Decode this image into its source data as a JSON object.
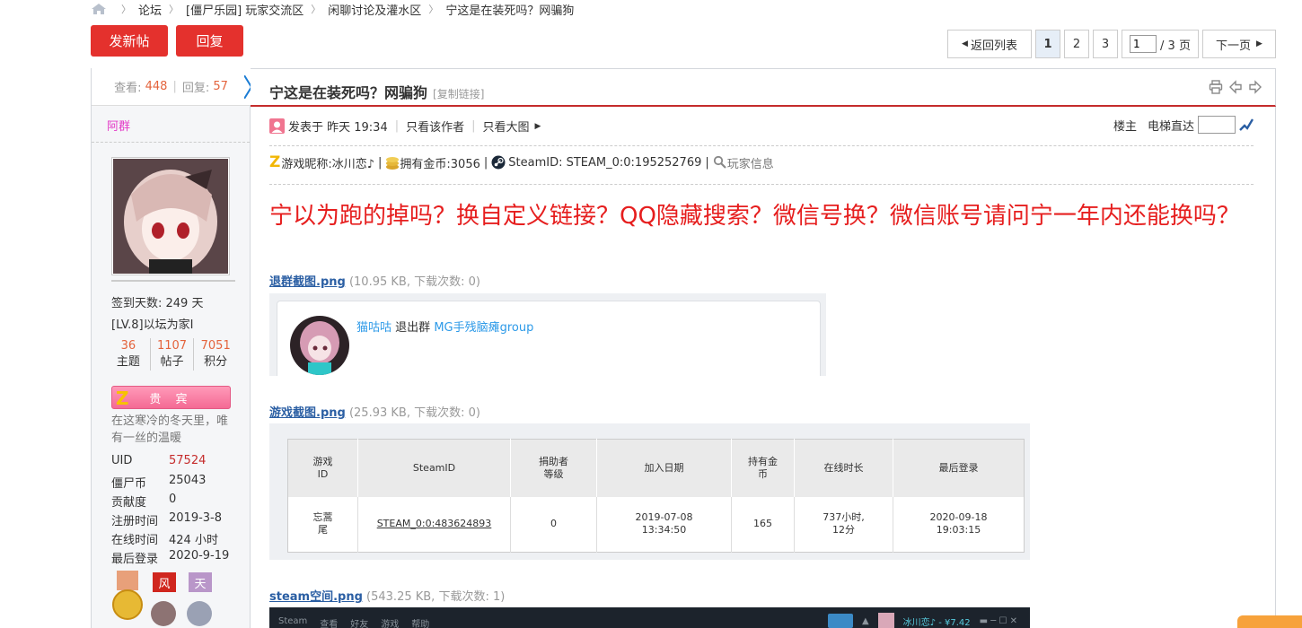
{
  "breadcrumb": {
    "items": [
      "论坛",
      "[僵尸乐园] 玩家交流区",
      "闲聊讨论及灌水区",
      "宁这是在装死吗？网骗狗"
    ]
  },
  "toolbar": {
    "new_post": "发新帖",
    "reply": "回复"
  },
  "pager": {
    "back": "返回列表",
    "pages": [
      "1",
      "2",
      "3"
    ],
    "current_input": "1",
    "total": "/ 3 页",
    "next": "下一页"
  },
  "stats": {
    "views_label": "查看:",
    "views": "448",
    "replies_label": "回复:",
    "replies": "57"
  },
  "author": {
    "name": "阿群",
    "sign_days": "签到天数: 249 天",
    "level": "[LV.8]以坛为家I",
    "counts": [
      {
        "value": "36",
        "label": "主题"
      },
      {
        "value": "1107",
        "label": "帖子"
      },
      {
        "value": "7051",
        "label": "积分"
      }
    ],
    "badge": "贵 宾",
    "motto": "在这寒冷的冬天里，唯有一丝的温暖",
    "fields": [
      {
        "k": "UID",
        "v": "57524"
      },
      {
        "k": "僵尸币",
        "v": "25043"
      },
      {
        "k": "贡献度",
        "v": "0"
      },
      {
        "k": "注册时间",
        "v": "2019-3-8"
      },
      {
        "k": "在线时间",
        "v": "424 小时"
      },
      {
        "k": "最后登录",
        "v": "2020-9-19"
      }
    ]
  },
  "thread": {
    "title": "宁这是在装死吗？网骗狗",
    "copy_link": "[复制链接]"
  },
  "meta": {
    "posted": "发表于 昨天 19:34",
    "only_author": "只看该作者",
    "only_big": "只看大图",
    "floor": "楼主",
    "jump": "电梯直达"
  },
  "gameinfo": {
    "nick": "游戏昵称:冰川恋♪",
    "coins": "拥有金币:3056",
    "steam": "SteamID: STEAM_0:0:195252769",
    "player_info": "玩家信息"
  },
  "post": {
    "text": "宁以为跑的掉吗？换自定义链接？QQ隐藏搜索？微信号换？微信账号请问宁一年内还能换吗？"
  },
  "attachments": [
    {
      "name": "退群截图.png",
      "info": "(10.95 KB, 下载次数: 0)"
    },
    {
      "name": "游戏截图.png",
      "info": "(25.93 KB, 下载次数: 0)"
    },
    {
      "name": "steam空间.png",
      "info": "(543.25 KB, 下载次数: 1)"
    }
  ],
  "shot1": {
    "user": "猫咕咕",
    "action": "退出群",
    "group": "MG手残脑瘫group"
  },
  "shot2": {
    "headers": [
      "游戏\nID",
      "SteamID",
      "捐助者\n等级",
      "加入日期",
      "持有金\n币",
      "在线时长",
      "最后登录"
    ],
    "row": [
      "忘蒿\n尾",
      "STEAM_0:0:483624893",
      "0",
      "2019-07-08\n13:34:50",
      "165",
      "737小时,\n12分",
      "2020-09-18\n19:03:15"
    ]
  },
  "shot3": {
    "menu": [
      "Steam",
      "查看",
      "好友",
      "游戏",
      "帮助"
    ],
    "user": "冰川恋♪ - ¥7.42"
  },
  "colors": {
    "accent_red": "#e4312d",
    "title_red": "#e61e1e",
    "link_blue": "#2a5ea3",
    "author_pink": "#e33bc7",
    "number_orange": "#e4643d"
  }
}
